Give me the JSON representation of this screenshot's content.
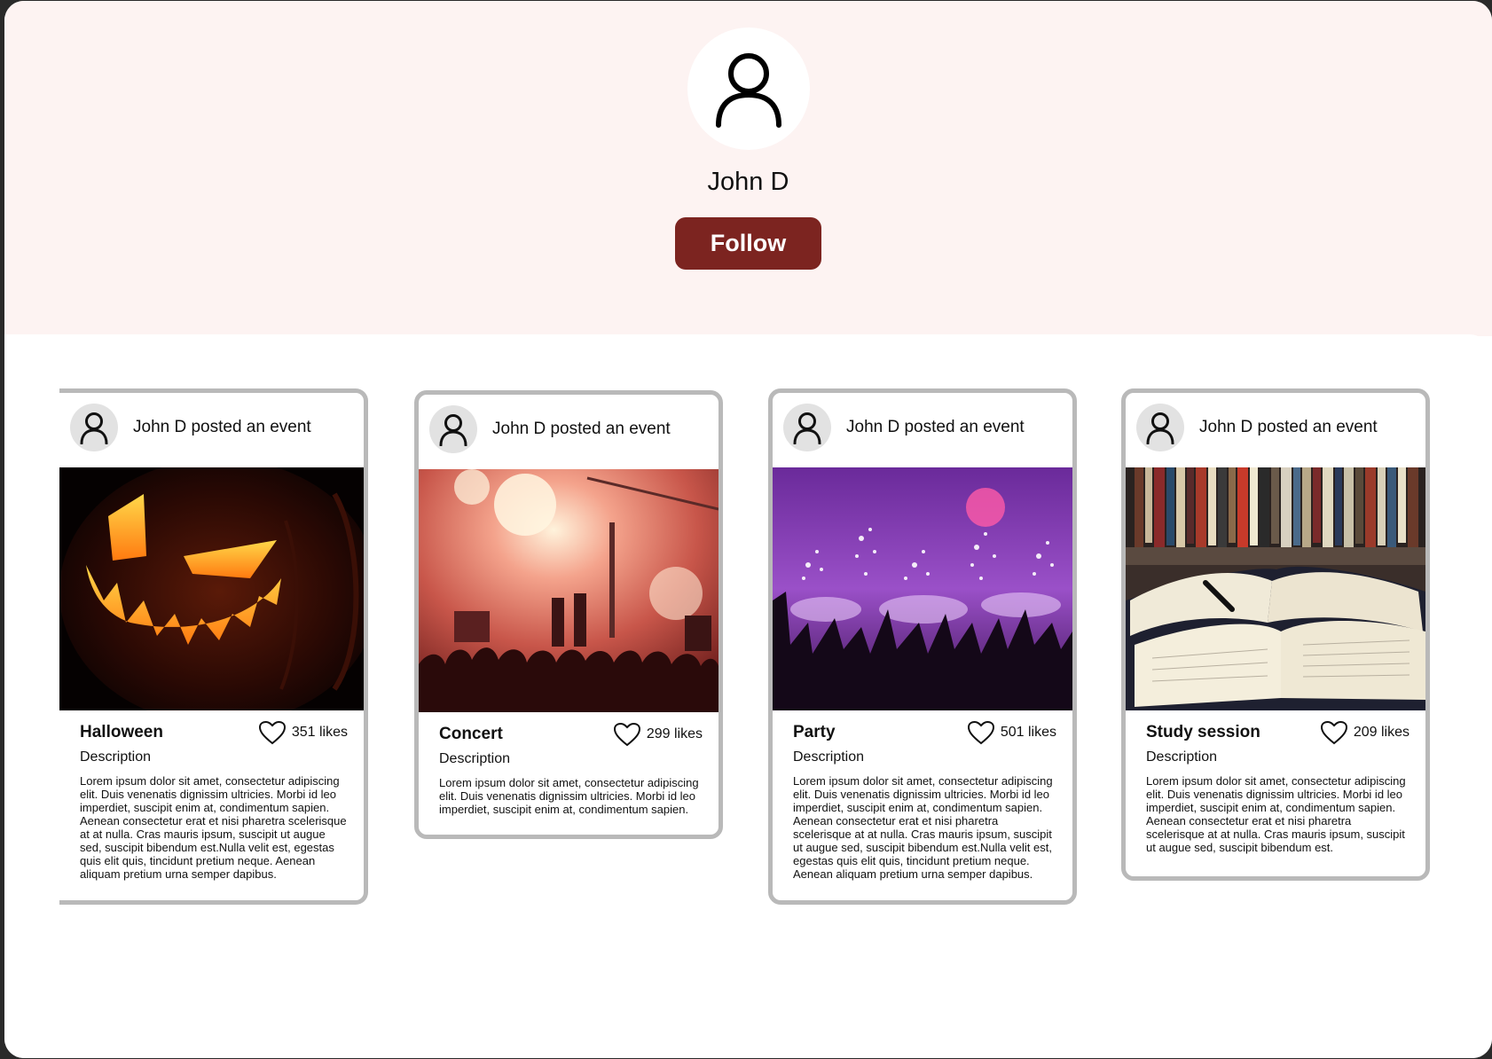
{
  "profile": {
    "name": "John D",
    "follow_label": "Follow"
  },
  "posts": [
    {
      "header": "John D posted an event",
      "title": "Halloween",
      "likes": "351 likes",
      "description_label": "Description",
      "description": "Lorem ipsum dolor sit amet, consectetur adipiscing elit. Duis venenatis  dignissim ultricies. Morbi id leo imperdiet, suscipit enim at,  condimentum sapien. Aenean consectetur erat et nisi pharetra scelerisque at at nulla. Cras mauris ipsum, suscipit ut augue sed, suscipit  bibendum est.Nulla velit est, egestas quis elit quis, tincidunt pretium neque. Aenean aliquam pretium urna semper dapibus.",
      "image": "jack-o-lantern"
    },
    {
      "header": "John D posted an event",
      "title": "Concert",
      "likes": "299 likes",
      "description_label": "Description",
      "description": "Lorem ipsum dolor sit amet, consectetur adipiscing elit. Duis venenatis  dignissim ultricies. Morbi id leo imperdiet, suscipit enim at,  condimentum sapien.",
      "image": "concert-stage"
    },
    {
      "header": "John D posted an event",
      "title": "Party",
      "likes": "501 likes",
      "description_label": "Description",
      "description": "Lorem ipsum dolor sit amet, consectetur adipiscing elit. Duis venenatis  dignissim ultricies. Morbi id leo imperdiet, suscipit enim at,  condimentum sapien. Aenean consectetur erat et nisi pharetra scelerisque at at nulla. Cras mauris ipsum, suscipit ut augue sed, suscipit  bibendum est.Nulla velit est, egestas quis elit quis, tincidunt pretium neque. Aenean aliquam pretium urna semper dapibus.",
      "image": "party-fireworks"
    },
    {
      "header": "John D posted an event",
      "title": "Study session",
      "likes": "209 likes",
      "description_label": "Description",
      "description": "Lorem ipsum dolor sit amet, consectetur adipiscing elit. Duis venenatis  dignissim ultricies. Morbi id leo imperdiet, suscipit enim at,  condimentum sapien. Aenean consectetur erat et nisi pharetra scelerisque at at nulla. Cras mauris ipsum, suscipit ut augue sed, suscipit  bibendum est.",
      "image": "open-books"
    }
  ],
  "colors": {
    "hero_background": "#fdf3f2",
    "follow_button": "#7c2420",
    "card_border": "#b9b9b9"
  }
}
